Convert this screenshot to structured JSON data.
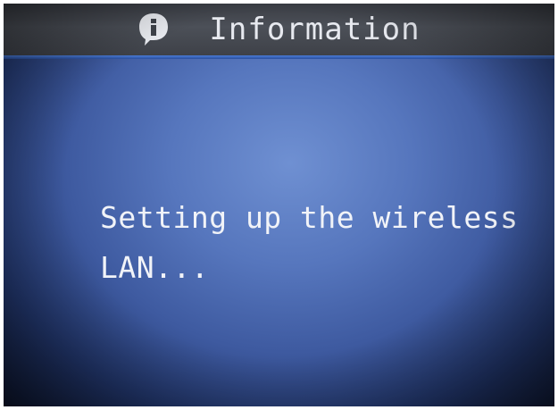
{
  "header": {
    "icon": "info-icon",
    "title": "Information"
  },
  "message": {
    "line1": "Setting up the wireless",
    "line2": "LAN..."
  },
  "colors": {
    "header_bg": "#44474e",
    "accent_line": "#3a66c4",
    "screen_bg": "#4e6db4",
    "text": "#f1f3f8"
  }
}
